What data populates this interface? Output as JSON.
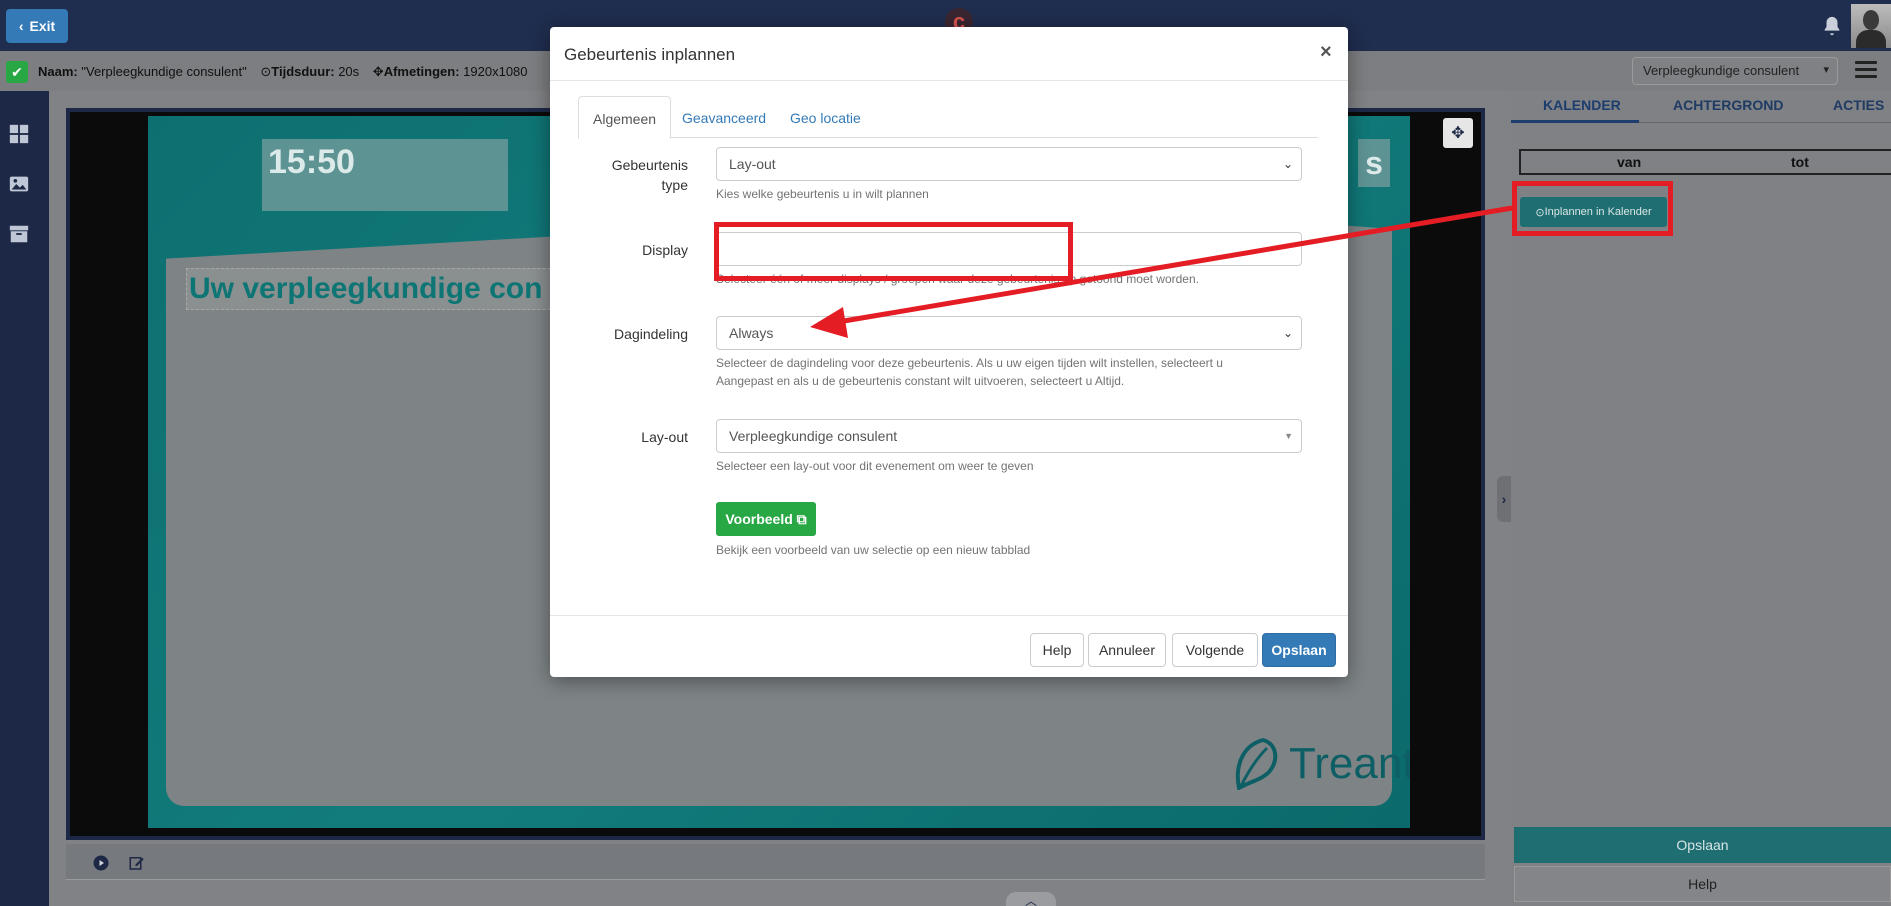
{
  "topbar": {
    "exit_label": "Exit"
  },
  "infobar": {
    "name_label": "Naam:",
    "name_value": "\"Verpleegkundige consulent\"",
    "duration_label": "Tijdsduur:",
    "duration_value": "20s",
    "dimensions_label": "Afmetingen:",
    "dimensions_value": "1920x1080",
    "layout_select_value": "Verpleegkundige consulent"
  },
  "slide": {
    "clock": "15:50",
    "title": "Uw verpleegkundige con",
    "corner_letter": "s",
    "logo_text": "Treant"
  },
  "right_panel": {
    "tabs": [
      "KALENDER",
      "ACHTERGROND",
      "ACTIES"
    ],
    "col_from": "van",
    "col_to": "tot",
    "schedule_button": "Inplannen in Kalender",
    "save_button": "Opslaan",
    "help_button": "Help"
  },
  "modal": {
    "title": "Gebeurtenis inplannen",
    "close": "×",
    "tabs": [
      "Algemeen",
      "Geavanceerd",
      "Geo locatie"
    ],
    "event_type": {
      "label_line1": "Gebeurtenis",
      "label_line2": "type",
      "value": "Lay-out",
      "help": "Kies welke gebeurtenis u in wilt plannen"
    },
    "display": {
      "label": "Display",
      "value": "",
      "help": "Selecteer één of meer displays / groepen waar deze gebeurtenis op getoond moet worden."
    },
    "dayparting": {
      "label": "Dagindeling",
      "value": "Always",
      "help_line1": "Selecteer de dagindeling voor deze gebeurtenis. Als u uw eigen tijden wilt instellen, selecteert u",
      "help_line2": "Aangepast en als u de gebeurtenis constant wilt uitvoeren, selecteert u Altijd."
    },
    "layout": {
      "label": "Lay-out",
      "value": "Verpleegkundige consulent",
      "help": "Selecteer een lay-out voor dit evenement om weer te geven"
    },
    "preview": {
      "button": "Voorbeeld",
      "help": "Bekijk een voorbeeld van uw selectie op een nieuw tabblad"
    },
    "footer": {
      "help": "Help",
      "cancel": "Annuleer",
      "next": "Volgende",
      "save": "Opslaan"
    }
  },
  "colors": {
    "annotation": "#e41d24",
    "primary": "#337ab7",
    "success": "#28a745",
    "sidebar": "#1c2846",
    "teal": "#1f6e72"
  }
}
